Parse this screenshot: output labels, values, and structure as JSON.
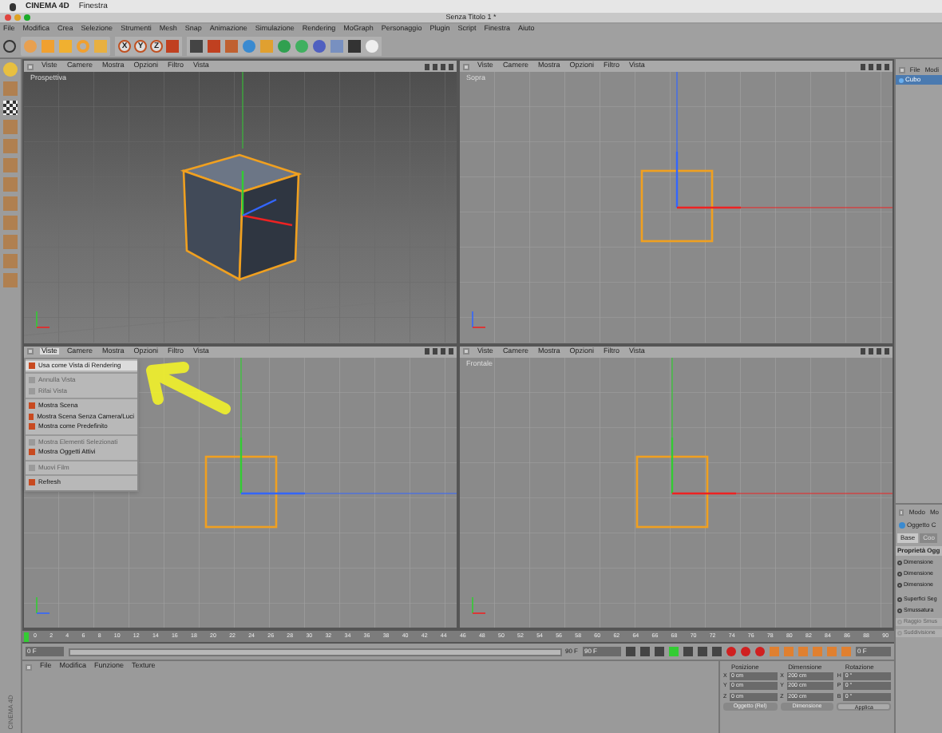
{
  "system_bar": {
    "app": "CINEMA 4D",
    "menus": [
      "Finestra"
    ]
  },
  "window": {
    "title": "Senza Titolo 1 *"
  },
  "menu": [
    "File",
    "Modifica",
    "Crea",
    "Selezione",
    "Strumenti",
    "Mesh",
    "Snap",
    "Animazione",
    "Simulazione",
    "Rendering",
    "MoGraph",
    "Personaggio",
    "Plugin",
    "Script",
    "Finestra",
    "Aiuto"
  ],
  "toolbar": {
    "axes": [
      "X",
      "Y",
      "Z"
    ]
  },
  "viewports": [
    {
      "kind": "perspective",
      "label": "Prospettiva",
      "menus": [
        {
          "label": "Viste",
          "open": false
        },
        {
          "label": "Camere",
          "open": false
        },
        {
          "label": "Mostra",
          "open": false
        },
        {
          "label": "Opzioni",
          "open": false
        },
        {
          "label": "Filtro",
          "open": false
        },
        {
          "label": "Vista",
          "open": false
        }
      ]
    },
    {
      "kind": "top",
      "label": "Sopra",
      "menus": [
        {
          "label": "Viste",
          "open": false
        },
        {
          "label": "Camere",
          "open": false
        },
        {
          "label": "Mostra",
          "open": false
        },
        {
          "label": "Opzioni",
          "open": false
        },
        {
          "label": "Filtro",
          "open": false
        },
        {
          "label": "Vista",
          "open": false
        }
      ]
    },
    {
      "kind": "right",
      "menus": [
        {
          "label": "Viste",
          "open": true
        },
        {
          "label": "Camere",
          "open": false
        },
        {
          "label": "Mostra",
          "open": false
        },
        {
          "label": "Opzioni",
          "open": false
        },
        {
          "label": "Filtro",
          "open": false
        },
        {
          "label": "Vista",
          "open": false
        }
      ]
    },
    {
      "kind": "front",
      "label": "Frontale",
      "menus": [
        {
          "label": "Viste",
          "open": false
        },
        {
          "label": "Camere",
          "open": false
        },
        {
          "label": "Mostra",
          "open": false
        },
        {
          "label": "Opzioni",
          "open": false
        },
        {
          "label": "Filtro",
          "open": false
        },
        {
          "label": "Vista",
          "open": false
        }
      ]
    }
  ],
  "view_menu": [
    {
      "label": "Usa come Vista di Rendering",
      "divider_before": false,
      "disabled": false,
      "selected": true
    },
    {
      "label": "Annulla Vista",
      "divider_before": true,
      "disabled": true,
      "selected": false
    },
    {
      "label": "Rifai Vista",
      "divider_before": false,
      "disabled": true,
      "selected": false
    },
    {
      "label": "Mostra Scena",
      "divider_before": true,
      "disabled": false,
      "selected": false
    },
    {
      "label": "Mostra Scena Senza Camera/Luci",
      "divider_before": false,
      "disabled": false,
      "selected": false
    },
    {
      "label": "Mostra come Predefinito",
      "divider_before": false,
      "disabled": false,
      "selected": false
    },
    {
      "label": "Mostra Elementi Selezionati",
      "divider_before": true,
      "disabled": true,
      "selected": false
    },
    {
      "label": "Mostra Oggetti Attivi",
      "divider_before": false,
      "disabled": false,
      "selected": false
    },
    {
      "label": "Muovi Film",
      "divider_before": true,
      "disabled": true,
      "selected": false
    },
    {
      "label": "Refresh",
      "divider_before": true,
      "disabled": false,
      "selected": false
    }
  ],
  "object_manager": {
    "menus": [
      "File",
      "Modi"
    ],
    "objects": [
      {
        "name": "Cubo",
        "selected": true
      }
    ]
  },
  "attribute_manager": {
    "menus": [
      "Modo",
      "Mo"
    ],
    "object": "Oggetto C",
    "tabs": [
      {
        "label": "Base",
        "selected": true
      },
      {
        "label": "Coo",
        "selected": false
      }
    ],
    "section": "Proprietà Ogg",
    "props": [
      {
        "label": "Dimensione",
        "disabled": false
      },
      {
        "label": "Dimensione",
        "disabled": false
      },
      {
        "label": "Dimensione",
        "disabled": false
      },
      {
        "label": "Superfici Seg",
        "disabled": false
      },
      {
        "label": "Smussatura",
        "disabled": false
      },
      {
        "label": "Raggio Smus",
        "disabled": true
      },
      {
        "label": "Suddivisione",
        "disabled": true
      }
    ]
  },
  "timeline": {
    "ticks": [
      "0",
      "2",
      "4",
      "6",
      "8",
      "10",
      "12",
      "14",
      "16",
      "18",
      "20",
      "22",
      "24",
      "26",
      "28",
      "30",
      "32",
      "34",
      "36",
      "38",
      "40",
      "42",
      "44",
      "46",
      "48",
      "50",
      "52",
      "54",
      "56",
      "58",
      "60",
      "62",
      "64",
      "66",
      "68",
      "70",
      "72",
      "74",
      "76",
      "78",
      "80",
      "82",
      "84",
      "86",
      "88",
      "90"
    ],
    "start": "0 F",
    "range": {
      "label": "90 F",
      "level": 1
    },
    "end": "90 F",
    "current": "0 F"
  },
  "material_manager": {
    "menus": [
      "File",
      "Modifica",
      "Funzione",
      "Texture"
    ]
  },
  "brand": "CINEMA 4D",
  "coordinates": {
    "columns": [
      {
        "title": "Posizione",
        "axes": [
          "X",
          "Y",
          "Z"
        ],
        "values": [
          "0 cm",
          "0 cm",
          "0 cm"
        ]
      },
      {
        "title": "Dimensione",
        "axes": [
          "X",
          "Y",
          "Z"
        ],
        "values": [
          "200 cm",
          "200 cm",
          "200 cm"
        ]
      },
      {
        "title": "Rotazione",
        "axes": [
          "H",
          "P",
          "B"
        ],
        "values": [
          "0 °",
          "0 °",
          "0 °"
        ]
      }
    ],
    "dropdowns": [
      "Oggetto (Rel)",
      "Dimensione"
    ],
    "apply": "Applica"
  }
}
